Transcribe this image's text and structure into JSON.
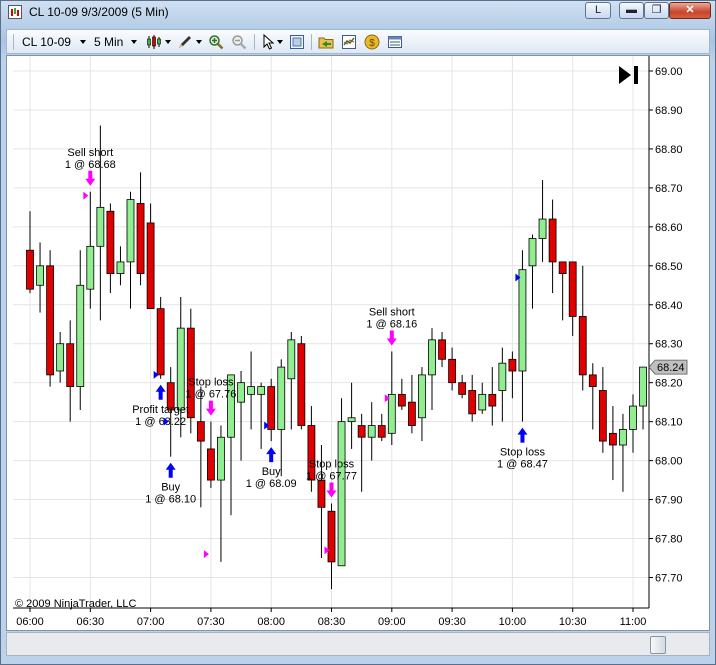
{
  "window": {
    "title": "CL 10-09  9/3/2009 (5 Min)",
    "caption_buttons": {
      "link": "L",
      "minimize": "▬",
      "maximize": "❐",
      "close": "✕"
    }
  },
  "toolbar": {
    "instrument": "CL 10-09",
    "interval": "5 Min",
    "icons": [
      "candlestick-style-icon",
      "drawing-pencil-icon",
      "zoom-in-icon",
      "zoom-out-icon",
      "cursor-arrow-icon",
      "chart-properties-icon",
      "folder-icon",
      "indicator-chart-icon",
      "strategy-coin-icon",
      "data-table-icon"
    ]
  },
  "copyright": "© 2009 NinjaTrader, LLC",
  "go_to_end_glyph": "▶|",
  "colors": {
    "up_candle": "#90ee90",
    "down_candle": "#e00000",
    "buy_arrow": "#0000ff",
    "sell_arrow": "#ff00ff",
    "price_marker_bg": "#bfbfbf"
  },
  "chart_data": {
    "type": "candlestick",
    "interval_minutes": 5,
    "x_tick_labels": [
      "06:00",
      "06:30",
      "07:00",
      "07:30",
      "08:00",
      "08:30",
      "09:00",
      "09:30",
      "10:00",
      "10:30",
      "11:00"
    ],
    "y_tick_labels": [
      "69.00",
      "68.90",
      "68.80",
      "68.70",
      "68.60",
      "68.50",
      "68.40",
      "68.30",
      "68.20",
      "68.10",
      "68.00",
      "67.90",
      "67.80",
      "67.70"
    ],
    "ylim": [
      67.63,
      69.04
    ],
    "last_price_label": "68.24",
    "grid": true,
    "candles": [
      {
        "t": "06:00",
        "o": 68.54,
        "h": 68.64,
        "l": 68.43,
        "c": 68.44
      },
      {
        "t": "06:05",
        "o": 68.45,
        "h": 68.56,
        "l": 68.38,
        "c": 68.5
      },
      {
        "t": "06:10",
        "o": 68.5,
        "h": 68.54,
        "l": 68.19,
        "c": 68.22
      },
      {
        "t": "06:15",
        "o": 68.23,
        "h": 68.33,
        "l": 68.2,
        "c": 68.3
      },
      {
        "t": "06:20",
        "o": 68.3,
        "h": 68.36,
        "l": 68.1,
        "c": 68.19
      },
      {
        "t": "06:25",
        "o": 68.19,
        "h": 68.54,
        "l": 68.13,
        "c": 68.45
      },
      {
        "t": "06:30",
        "o": 68.44,
        "h": 68.69,
        "l": 68.39,
        "c": 68.55
      },
      {
        "t": "06:35",
        "o": 68.55,
        "h": 68.86,
        "l": 68.36,
        "c": 68.65
      },
      {
        "t": "06:40",
        "o": 68.64,
        "h": 68.66,
        "l": 68.43,
        "c": 68.48
      },
      {
        "t": "06:45",
        "o": 68.48,
        "h": 68.55,
        "l": 68.45,
        "c": 68.51
      },
      {
        "t": "06:50",
        "o": 68.51,
        "h": 68.69,
        "l": 68.39,
        "c": 68.67
      },
      {
        "t": "06:55",
        "o": 68.66,
        "h": 68.74,
        "l": 68.45,
        "c": 68.48
      },
      {
        "t": "07:00",
        "o": 68.61,
        "h": 68.66,
        "l": 68.39,
        "c": 68.39
      },
      {
        "t": "07:05",
        "o": 68.39,
        "h": 68.42,
        "l": 68.21,
        "c": 68.22
      },
      {
        "t": "07:10",
        "o": 68.2,
        "h": 68.24,
        "l": 68.01,
        "c": 68.13
      },
      {
        "t": "07:15",
        "o": 68.13,
        "h": 68.42,
        "l": 68.06,
        "c": 68.34
      },
      {
        "t": "07:20",
        "o": 68.34,
        "h": 68.39,
        "l": 68.07,
        "c": 68.11
      },
      {
        "t": "07:25",
        "o": 68.1,
        "h": 68.19,
        "l": 67.88,
        "c": 68.05
      },
      {
        "t": "07:30",
        "o": 68.03,
        "h": 68.1,
        "l": 67.93,
        "c": 67.95
      },
      {
        "t": "07:35",
        "o": 67.95,
        "h": 68.09,
        "l": 67.74,
        "c": 68.06
      },
      {
        "t": "07:40",
        "o": 68.06,
        "h": 68.16,
        "l": 67.86,
        "c": 68.22
      },
      {
        "t": "07:45",
        "o": 68.15,
        "h": 68.23,
        "l": 68.0,
        "c": 68.2
      },
      {
        "t": "07:50",
        "o": 68.17,
        "h": 68.28,
        "l": 68.08,
        "c": 68.19
      },
      {
        "t": "07:55",
        "o": 68.17,
        "h": 68.2,
        "l": 68.03,
        "c": 68.19
      },
      {
        "t": "08:00",
        "o": 68.19,
        "h": 68.21,
        "l": 68.05,
        "c": 68.08
      },
      {
        "t": "08:05",
        "o": 68.08,
        "h": 68.26,
        "l": 67.96,
        "c": 68.24
      },
      {
        "t": "08:10",
        "o": 68.21,
        "h": 68.33,
        "l": 68.08,
        "c": 68.31
      },
      {
        "t": "08:15",
        "o": 68.3,
        "h": 68.32,
        "l": 68.08,
        "c": 68.09
      },
      {
        "t": "08:20",
        "o": 68.09,
        "h": 68.14,
        "l": 67.92,
        "c": 67.95
      },
      {
        "t": "08:25",
        "o": 67.95,
        "h": 68.04,
        "l": 67.75,
        "c": 67.88
      },
      {
        "t": "08:30",
        "o": 67.87,
        "h": 67.89,
        "l": 67.67,
        "c": 67.74
      },
      {
        "t": "08:35",
        "o": 67.73,
        "h": 68.16,
        "l": 67.74,
        "c": 68.1
      },
      {
        "t": "08:40",
        "o": 68.1,
        "h": 68.2,
        "l": 68.03,
        "c": 68.11
      },
      {
        "t": "08:45",
        "o": 68.09,
        "h": 68.12,
        "l": 67.92,
        "c": 68.06
      },
      {
        "t": "08:50",
        "o": 68.06,
        "h": 68.15,
        "l": 68.0,
        "c": 68.09
      },
      {
        "t": "08:55",
        "o": 68.09,
        "h": 68.12,
        "l": 68.05,
        "c": 68.06
      },
      {
        "t": "09:00",
        "o": 68.07,
        "h": 68.28,
        "l": 68.04,
        "c": 68.17
      },
      {
        "t": "09:05",
        "o": 68.17,
        "h": 68.21,
        "l": 68.13,
        "c": 68.14
      },
      {
        "t": "09:10",
        "o": 68.15,
        "h": 68.22,
        "l": 68.07,
        "c": 68.09
      },
      {
        "t": "09:15",
        "o": 68.11,
        "h": 68.24,
        "l": 68.05,
        "c": 68.22
      },
      {
        "t": "09:20",
        "o": 68.22,
        "h": 68.34,
        "l": 68.13,
        "c": 68.31
      },
      {
        "t": "09:25",
        "o": 68.31,
        "h": 68.33,
        "l": 68.24,
        "c": 68.26
      },
      {
        "t": "09:30",
        "o": 68.26,
        "h": 68.29,
        "l": 68.18,
        "c": 68.2
      },
      {
        "t": "09:35",
        "o": 68.2,
        "h": 68.22,
        "l": 68.16,
        "c": 68.17
      },
      {
        "t": "09:40",
        "o": 68.18,
        "h": 68.22,
        "l": 68.1,
        "c": 68.12
      },
      {
        "t": "09:45",
        "o": 68.13,
        "h": 68.2,
        "l": 68.12,
        "c": 68.17
      },
      {
        "t": "09:50",
        "o": 68.17,
        "h": 68.24,
        "l": 68.09,
        "c": 68.14
      },
      {
        "t": "09:55",
        "o": 68.18,
        "h": 68.29,
        "l": 68.1,
        "c": 68.25
      },
      {
        "t": "10:00",
        "o": 68.26,
        "h": 68.28,
        "l": 68.16,
        "c": 68.23
      },
      {
        "t": "10:05",
        "o": 68.23,
        "h": 68.54,
        "l": 68.1,
        "c": 68.49
      },
      {
        "t": "10:10",
        "o": 68.5,
        "h": 68.58,
        "l": 68.39,
        "c": 68.57
      },
      {
        "t": "10:15",
        "o": 68.57,
        "h": 68.72,
        "l": 68.51,
        "c": 68.62
      },
      {
        "t": "10:20",
        "o": 68.62,
        "h": 68.67,
        "l": 68.43,
        "c": 68.51
      },
      {
        "t": "10:25",
        "o": 68.51,
        "h": 68.5,
        "l": 68.36,
        "c": 68.48
      },
      {
        "t": "10:30",
        "o": 68.51,
        "h": 68.5,
        "l": 68.32,
        "c": 68.37
      },
      {
        "t": "10:35",
        "o": 68.37,
        "h": 68.5,
        "l": 68.18,
        "c": 68.22
      },
      {
        "t": "10:40",
        "o": 68.22,
        "h": 68.25,
        "l": 68.08,
        "c": 68.19
      },
      {
        "t": "10:45",
        "o": 68.18,
        "h": 68.24,
        "l": 68.02,
        "c": 68.05
      },
      {
        "t": "10:50",
        "o": 68.07,
        "h": 68.14,
        "l": 67.95,
        "c": 68.04
      },
      {
        "t": "10:55",
        "o": 68.04,
        "h": 68.12,
        "l": 67.92,
        "c": 68.08
      },
      {
        "t": "11:00",
        "o": 68.08,
        "h": 68.17,
        "l": 68.02,
        "c": 68.14
      },
      {
        "t": "11:05",
        "o": 68.14,
        "h": 68.22,
        "l": 68.08,
        "c": 68.24
      }
    ],
    "executions": [
      {
        "label": "Sell short",
        "detail": "1 @ 68.68",
        "side": "sell",
        "bar": "06:30",
        "price": 68.68,
        "label_pos": "above"
      },
      {
        "label": "Profit target",
        "detail": "1 @ 68.22",
        "side": "buy",
        "bar": "07:05",
        "price": 68.22,
        "label_pos": "below"
      },
      {
        "label": "Stop loss",
        "detail": "1 @ 67.76",
        "side": "sell",
        "bar": "07:30",
        "price": 67.76,
        "label_pos": "above"
      },
      {
        "label": "Buy",
        "detail": "1 @ 68.10",
        "side": "buy",
        "bar": "07:10",
        "price": 68.1,
        "label_pos": "below"
      },
      {
        "label": "Buy",
        "detail": "1 @ 68.09",
        "side": "buy",
        "bar": "08:00",
        "price": 68.09,
        "label_pos": "below"
      },
      {
        "label": "Stop loss",
        "detail": "1 @ 67.77",
        "side": "sell",
        "bar": "08:30",
        "price": 67.77,
        "label_pos": "above"
      },
      {
        "label": "Sell short",
        "detail": "1 @ 68.16",
        "side": "sell",
        "bar": "09:00",
        "price": 68.16,
        "label_pos": "above"
      },
      {
        "label": "Stop loss",
        "detail": "1 @ 68.47",
        "side": "buy",
        "bar": "10:05",
        "price": 68.47,
        "label_pos": "below"
      }
    ]
  }
}
